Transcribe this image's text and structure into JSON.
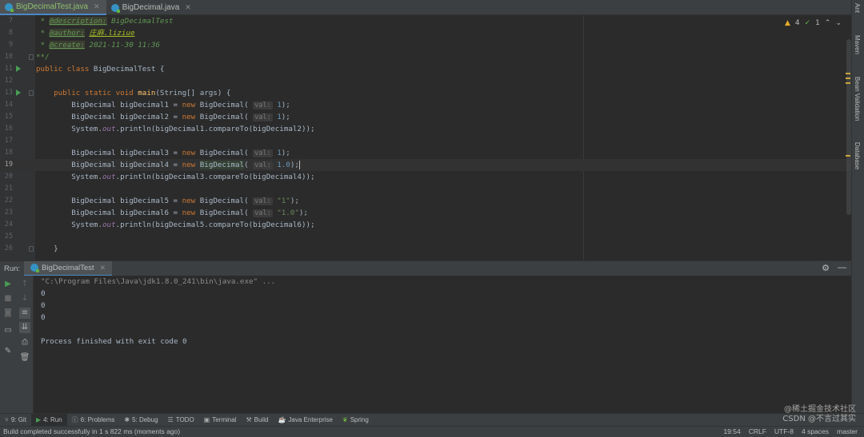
{
  "tabs": [
    {
      "label": "BigDecimalTest.java",
      "active": true
    },
    {
      "label": "BigDecimal.java",
      "active": false
    }
  ],
  "inspection": {
    "warnings": "4",
    "weak": "1"
  },
  "right_tools": [
    "Ant",
    "Maven",
    "Bean Validation",
    "Database"
  ],
  "editor": {
    "line_numbers": [
      "7",
      "8",
      "9",
      "10",
      "11",
      "12",
      "13",
      "14",
      "15",
      "16",
      "17",
      "18",
      "19",
      "20",
      "21",
      "22",
      "23",
      "24",
      "25",
      "26"
    ],
    "current_line": "19",
    "description_tag": "@description:",
    "description_value": "BigDecimalTest",
    "author_tag": "@author:",
    "author_value": "庄麻.liziue",
    "create_tag": "@create:",
    "create_value": "2021-11-30 11:36",
    "comment_end": "**/",
    "class_decl": {
      "modifiers": "public class ",
      "name": "BigDecimalTest {"
    },
    "main_decl": {
      "modifiers": "public static void ",
      "name": "main",
      "params": "(String[] args) {"
    },
    "type": "BigDecimal",
    "new_kw": "new",
    "vars": [
      "bigDecimal1",
      "bigDecimal2",
      "bigDecimal3",
      "bigDecimal4",
      "bigDecimal5",
      "bigDecimal6"
    ],
    "hint": "val:",
    "args": [
      "1",
      "1",
      "1",
      "1.0",
      "\"1\"",
      "\"1.0\""
    ],
    "system": "System.",
    "out": "out",
    "println": ".println(",
    "compare": [
      "bigDecimal1.compareTo(bigDecimal2));",
      "bigDecimal3.compareTo(bigDecimal4));",
      "bigDecimal5.compareTo(bigDecimal6));"
    ],
    "closing": "}"
  },
  "run": {
    "label": "Run:",
    "tab": "BigDecimalTest",
    "command": "\"C:\\Program Files\\Java\\jdk1.8.0_241\\bin\\java.exe\" ...",
    "outputs": [
      "0",
      "0",
      "0"
    ],
    "finished": "Process finished with exit code 0"
  },
  "toolwindows": [
    {
      "label": "9: Git",
      "icon": "git-icon"
    },
    {
      "label": "4: Run",
      "icon": "run-icon",
      "active": true
    },
    {
      "label": "6: Problems",
      "icon": "problems-icon"
    },
    {
      "label": "5: Debug",
      "icon": "debug-icon"
    },
    {
      "label": "TODO",
      "icon": "todo-icon"
    },
    {
      "label": "Terminal",
      "icon": "terminal-icon"
    },
    {
      "label": "Build",
      "icon": "build-icon"
    },
    {
      "label": "Java Enterprise",
      "icon": "java-enterprise-icon"
    },
    {
      "label": "Spring",
      "icon": "spring-icon"
    }
  ],
  "status": {
    "message": "Build completed successfully in 1 s 822 ms (moments ago)",
    "position": "19:54",
    "line_sep": "CRLF",
    "encoding": "UTF-8",
    "indent": "4 spaces",
    "branch": "master"
  },
  "watermark": {
    "line1": "@稀土掘金技术社区",
    "line2": "CSDN @不言过其实"
  }
}
